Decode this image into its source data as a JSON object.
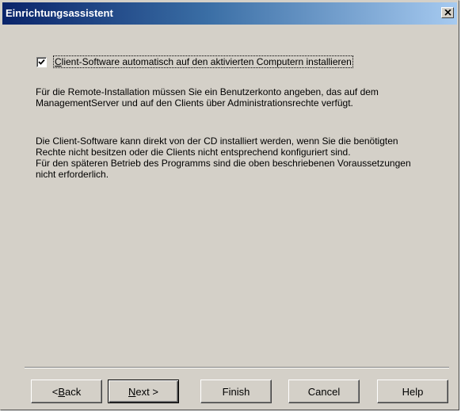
{
  "window": {
    "title": "Einrichtungsassistent"
  },
  "checkbox": {
    "checked": true,
    "label_hotkey": "C",
    "label_rest": "lient-Software automatisch auf den aktivierten Computern installieren"
  },
  "paragraphs": {
    "p1": "Für die Remote-Installation müssen Sie ein Benutzerkonto angeben, das auf dem ManagementServer und auf den Clients über Administrationsrechte verfügt.",
    "p2": "Die Client-Software kann direkt von der CD installiert werden, wenn Sie die benötigten Rechte nicht besitzen oder die Clients nicht entsprechend konfiguriert sind.",
    "p3": "Für den späteren Betrieb des Programms sind die oben beschriebenen Voraussetzungen nicht erforderlich."
  },
  "buttons": {
    "back_prefix": "< ",
    "back_hotkey": "B",
    "back_rest": "ack",
    "next_hotkey": "N",
    "next_rest": "ext >",
    "finish": "Finish",
    "cancel": "Cancel",
    "help": "Help"
  },
  "icons": {
    "close": "close-icon",
    "check": "checkmark-icon"
  }
}
